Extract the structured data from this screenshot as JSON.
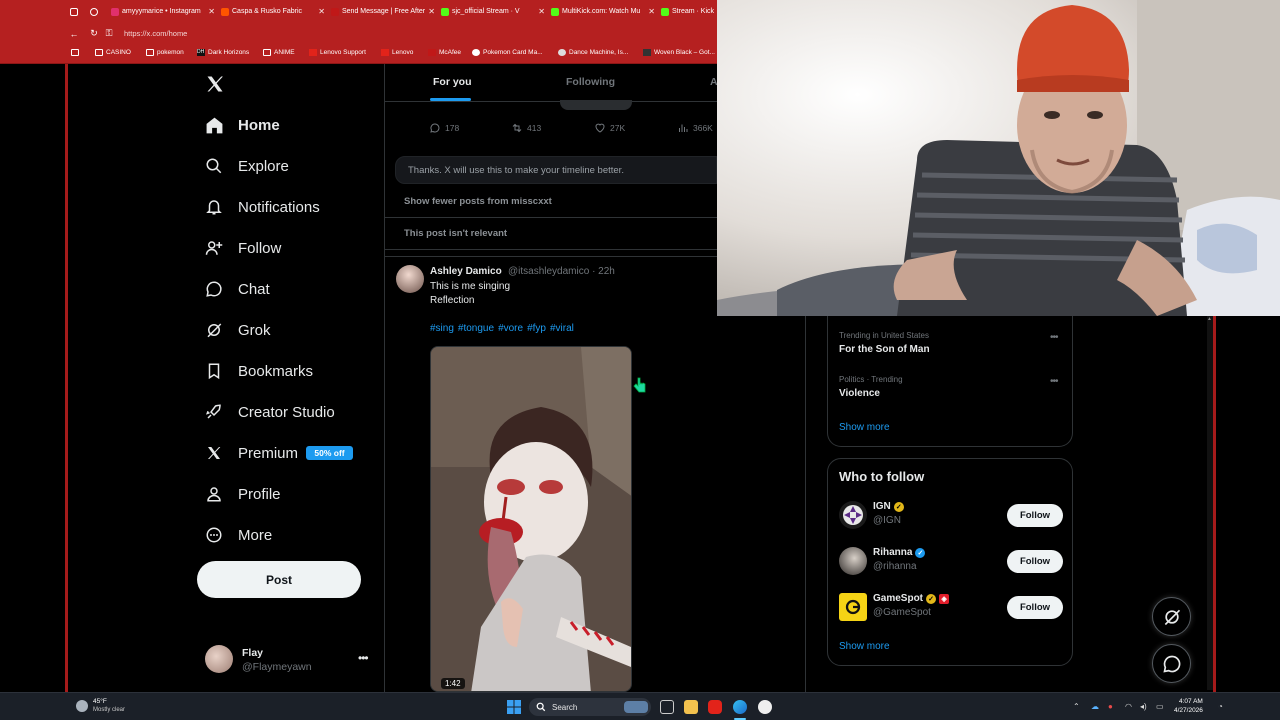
{
  "browser": {
    "tabs": [
      {
        "title": "amyyymarice • Instagram",
        "color": "#e1306c"
      },
      {
        "title": "Caspa & Rusko Fabric",
        "color": "#ff5500"
      },
      {
        "title": "Send Message | Free After",
        "color": "#c01818"
      },
      {
        "title": "sjc_official Stream · V",
        "color": "#53fc18"
      },
      {
        "title": "MultiKick.com: Watch Mu",
        "color": "#53fc18"
      },
      {
        "title": "Stream · Kick",
        "color": "#53fc18"
      }
    ],
    "url": "https://x.com/home",
    "bookmarks": [
      "CASINO",
      "pokemon",
      "Dark Horizons",
      "ANIME",
      "Lenovo Support",
      "Lenovo",
      "McAfee",
      "Pokemon Card Ma...",
      "Dance Machine, Is...",
      "Woven Black – Got..."
    ]
  },
  "nav": {
    "items": [
      {
        "label": "Home",
        "icon": "home-icon"
      },
      {
        "label": "Explore",
        "icon": "search-icon"
      },
      {
        "label": "Notifications",
        "icon": "bell-icon"
      },
      {
        "label": "Follow",
        "icon": "add-person-icon"
      },
      {
        "label": "Chat",
        "icon": "chat-bubble-icon"
      },
      {
        "label": "Grok",
        "icon": "grok-icon"
      },
      {
        "label": "Bookmarks",
        "icon": "bookmark-icon"
      },
      {
        "label": "Creator Studio",
        "icon": "rocket-icon"
      },
      {
        "label": "Premium",
        "icon": "x-logo-icon"
      },
      {
        "label": "Profile",
        "icon": "person-icon"
      },
      {
        "label": "More",
        "icon": "more-circle-icon"
      }
    ],
    "premium_badge": "50% off",
    "post_button": "Post",
    "account": {
      "name": "Flay",
      "handle": "@Flaymeyawn"
    }
  },
  "feed": {
    "tabs": [
      "For you",
      "Following",
      "A"
    ],
    "stats": {
      "replies": "178",
      "reposts": "413",
      "likes": "27K",
      "views": "366K"
    },
    "feedback_text": "Thanks. X will use this to make your timeline better.",
    "options": [
      "Show fewer posts from misscxxt",
      "This post isn't relevant"
    ],
    "post": {
      "name": "Ashley Damico",
      "meta": "@itsashleydamico · 22h",
      "line1": "This is me singing",
      "line2": "Reflection",
      "hashtags": [
        "#sing",
        "#tongue",
        "#vore",
        "#fyp",
        "#viral"
      ],
      "duration": "1:42"
    }
  },
  "sidebar": {
    "trends": [
      {
        "category": "Trending in United States",
        "name": "For the Son of Man"
      },
      {
        "category": "Politics · Trending",
        "name": "Violence"
      }
    ],
    "trends_show_more": "Show more",
    "who_to_follow_title": "Who to follow",
    "suggestions": [
      {
        "name": "IGN",
        "handle": "@IGN",
        "badge": "#e2b719"
      },
      {
        "name": "Rihanna",
        "handle": "@rihanna",
        "badge": "#1d9bf0"
      },
      {
        "name": "GameSpot",
        "handle": "@GameSpot",
        "badge": "#e2b719"
      }
    ],
    "follow_label": "Follow",
    "wtf_show_more": "Show more"
  },
  "taskbar": {
    "temperature": "45°F",
    "weather": "Mostly clear",
    "search": "Search",
    "time": "4:07 AM",
    "date": "4/27/2026"
  },
  "colors": {
    "accent": "#1d9bf0",
    "browser_red": "#b52020",
    "background": "#000000"
  }
}
